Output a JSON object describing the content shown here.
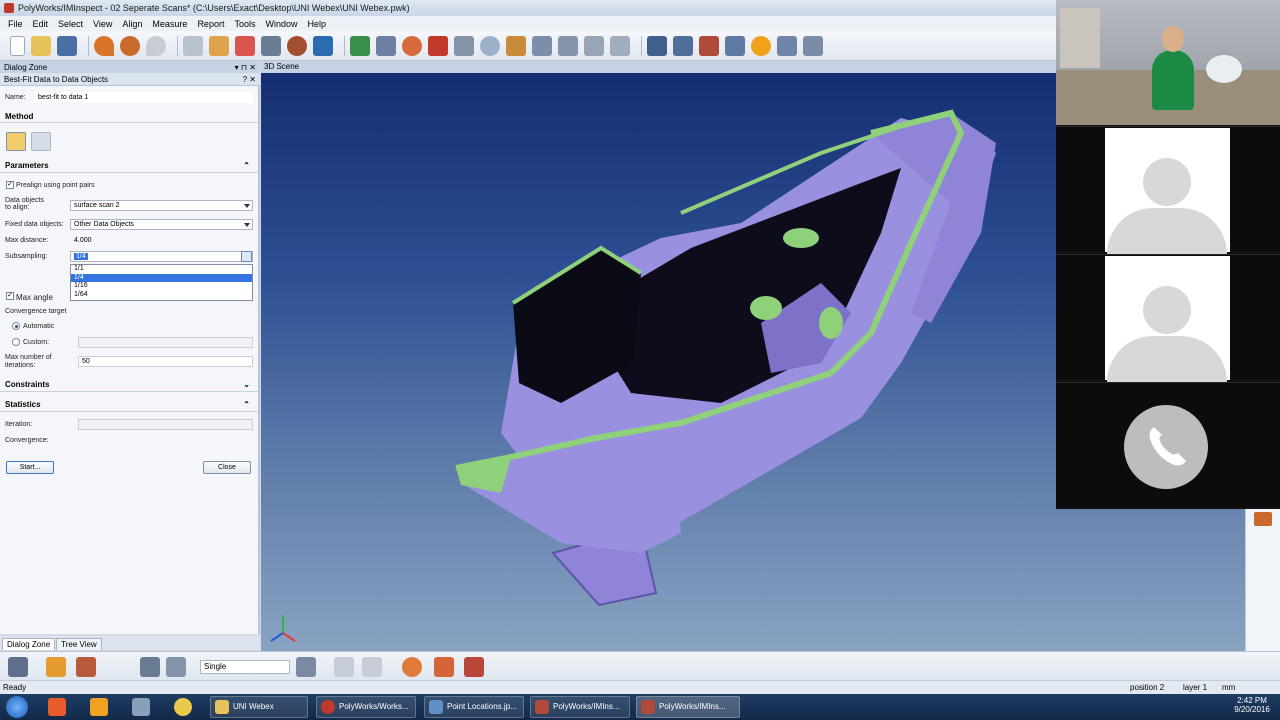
{
  "window": {
    "title": "PolyWorks/IMInspect - 02 Seperate Scans* (C:\\Users\\Exact\\Desktop\\UNI Webex\\UNI Webex.pwk)"
  },
  "menu": [
    "File",
    "Edit",
    "Select",
    "View",
    "Align",
    "Measure",
    "Report",
    "Tools",
    "Window",
    "Help"
  ],
  "dialog_zone": {
    "header": "Dialog Zone",
    "subheader": "Best-Fit Data to Data Objects",
    "name_label": "Name:",
    "name_value": "best-fit to data 1",
    "method_label": "Method",
    "parameters_label": "Parameters",
    "prealign_label": "Prealign using point pairs",
    "data_objects_label_1": "Data objects",
    "data_objects_label_2": "to align:",
    "data_objects_value": "surface scan 2",
    "fixed_label": "Fixed data objects:",
    "fixed_value": "Other Data Objects",
    "max_distance_label": "Max distance:",
    "max_distance_value": "4.000",
    "subsampling_label": "Subsampling:",
    "subsampling_value": "1/4",
    "subsampling_options": [
      "1/1",
      "1/4",
      "1/16",
      "1/64"
    ],
    "max_angle_label": "Max angle",
    "convergence_target_label": "Convergence target",
    "automatic_label": "Automatic",
    "custom_label": "Custom:",
    "max_iter_label_1": "Max number of",
    "max_iter_label_2": "iterations:",
    "max_iter_value": "50",
    "constraints_label": "Constraints",
    "statistics_label": "Statistics",
    "iteration_label": "Iteration:",
    "convergence_label": "Convergence:",
    "start_button": "Start...",
    "close_button": "Close"
  },
  "scene": {
    "header": "3D Scene"
  },
  "bottom_tabs": [
    "Dialog Zone",
    "Tree View"
  ],
  "bottom_toolbar": {
    "mode_select": "Single"
  },
  "status": {
    "left": "Ready",
    "position": "position 2",
    "layer": "layer 1",
    "units": "mm"
  },
  "taskbar": {
    "items": [
      "UNI Webex",
      "PolyWorks/Works...",
      "Point Locations.jp...",
      "PolyWorks/IMIns...",
      "PolyWorks/IMIns..."
    ],
    "time": "2:42 PM",
    "date": "9/20/2016"
  },
  "colors": {
    "scene_top": "#162e72",
    "part_body": "#8f84d8",
    "part_edge": "#8fd07a",
    "accent": "#3374e1"
  }
}
